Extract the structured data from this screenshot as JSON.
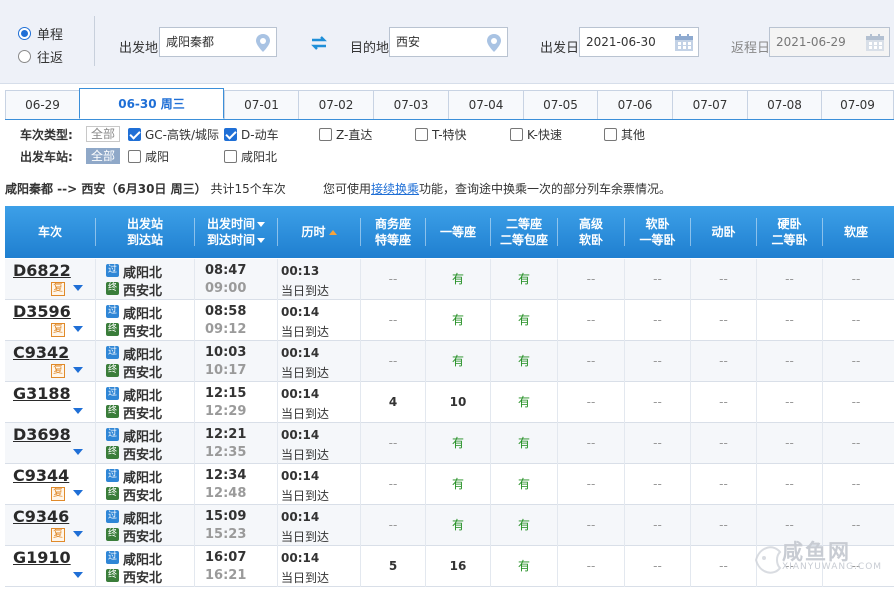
{
  "search": {
    "trip_types": [
      {
        "label": "单程",
        "selected": true
      },
      {
        "label": "往返",
        "selected": false
      }
    ],
    "from_label": "出发地",
    "from_value": "咸阳秦都",
    "to_label": "目的地",
    "to_value": "西安",
    "depart_label": "出发日",
    "depart_value": "2021-06-30",
    "return_label": "返程日",
    "return_value": "2021-06-29"
  },
  "date_tabs": [
    "06-29",
    "06-30 周三",
    "07-01",
    "07-02",
    "07-03",
    "07-04",
    "07-05",
    "07-06",
    "07-07",
    "07-08",
    "07-09"
  ],
  "active_tab": 1,
  "filters": {
    "type_title": "车次类型:",
    "station_title": "出发车站:",
    "all_label": "全部",
    "types": [
      {
        "label": "GC-高铁/城际",
        "checked": true
      },
      {
        "label": "D-动车",
        "checked": true
      },
      {
        "label": "Z-直达",
        "checked": false
      },
      {
        "label": "T-特快",
        "checked": false
      },
      {
        "label": "K-快速",
        "checked": false
      },
      {
        "label": "其他",
        "checked": false
      }
    ],
    "stations": [
      {
        "label": "咸阳",
        "checked": false
      },
      {
        "label": "咸阳北",
        "checked": false
      }
    ]
  },
  "summary": {
    "route": "咸阳秦都 --> 西安（6月30日  周三）",
    "count": "共计15个车次",
    "tip_before": "您可使用",
    "tip_link": "接续换乘",
    "tip_after": "功能，查询途中换乘一次的部分列车余票情况。"
  },
  "columns": {
    "train": "车次",
    "station_top": "出发站",
    "station_bottom": "到达站",
    "time_top": "出发时间",
    "time_bottom": "到达时间",
    "duration": "历时",
    "business_top": "商务座",
    "business_bottom": "特等座",
    "first": "一等座",
    "second_top": "二等座",
    "second_bottom": "二等包座",
    "premium_top": "高级",
    "premium_bottom": "软卧",
    "soft_top": "软卧",
    "soft_bottom": "一等卧",
    "dongwo": "动卧",
    "hard_top": "硬卧",
    "hard_bottom": "二等卧",
    "softseat": "软座"
  },
  "badges": {
    "pass": "过",
    "end": "终",
    "fu": "复"
  },
  "trains": [
    {
      "no": "D6822",
      "fu": true,
      "from": "咸阳北",
      "to": "西安北",
      "dep": "08:47",
      "arr": "09:00",
      "dur": "00:13",
      "day": "当日到达",
      "seats": [
        "--",
        "有",
        "有",
        "--",
        "--",
        "--",
        "--",
        "--"
      ]
    },
    {
      "no": "D3596",
      "fu": true,
      "from": "咸阳北",
      "to": "西安北",
      "dep": "08:58",
      "arr": "09:12",
      "dur": "00:14",
      "day": "当日到达",
      "seats": [
        "--",
        "有",
        "有",
        "--",
        "--",
        "--",
        "--",
        "--"
      ]
    },
    {
      "no": "C9342",
      "fu": true,
      "from": "咸阳北",
      "to": "西安北",
      "dep": "10:03",
      "arr": "10:17",
      "dur": "00:14",
      "day": "当日到达",
      "seats": [
        "--",
        "有",
        "有",
        "--",
        "--",
        "--",
        "--",
        "--"
      ]
    },
    {
      "no": "G3188",
      "fu": false,
      "from": "咸阳北",
      "to": "西安北",
      "dep": "12:15",
      "arr": "12:29",
      "dur": "00:14",
      "day": "当日到达",
      "seats": [
        "4",
        "10",
        "有",
        "--",
        "--",
        "--",
        "--",
        "--"
      ]
    },
    {
      "no": "D3698",
      "fu": false,
      "from": "咸阳北",
      "to": "西安北",
      "dep": "12:21",
      "arr": "12:35",
      "dur": "00:14",
      "day": "当日到达",
      "seats": [
        "--",
        "有",
        "有",
        "--",
        "--",
        "--",
        "--",
        "--"
      ]
    },
    {
      "no": "C9344",
      "fu": true,
      "from": "咸阳北",
      "to": "西安北",
      "dep": "12:34",
      "arr": "12:48",
      "dur": "00:14",
      "day": "当日到达",
      "seats": [
        "--",
        "有",
        "有",
        "--",
        "--",
        "--",
        "--",
        "--"
      ]
    },
    {
      "no": "C9346",
      "fu": true,
      "from": "咸阳北",
      "to": "西安北",
      "dep": "15:09",
      "arr": "15:23",
      "dur": "00:14",
      "day": "当日到达",
      "seats": [
        "--",
        "有",
        "有",
        "--",
        "--",
        "--",
        "--",
        "--"
      ]
    },
    {
      "no": "G1910",
      "fu": false,
      "from": "咸阳北",
      "to": "西安北",
      "dep": "16:07",
      "arr": "16:21",
      "dur": "00:14",
      "day": "当日到达",
      "seats": [
        "5",
        "16",
        "有",
        "--",
        "--",
        "--",
        "--",
        "--"
      ]
    }
  ],
  "watermark": {
    "name": "咸鱼网",
    "url": "XIANYUWANG.COM"
  },
  "colors": {
    "accent": "#1f6fd6",
    "header": "#2a8ad9",
    "available": "#1e8c1e"
  }
}
